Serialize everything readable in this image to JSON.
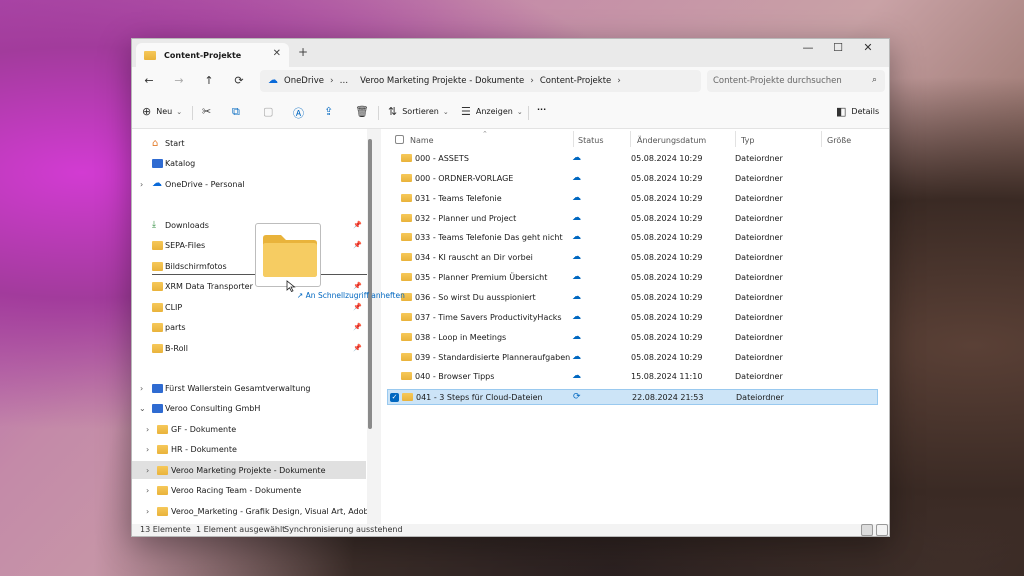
{
  "window": {
    "tab_title": "Content-Projekte",
    "tab_close": "✕",
    "new_tab": "+",
    "controls": {
      "minimize": "—",
      "maximize": "☐",
      "close": "✕"
    }
  },
  "nav": {
    "back": "←",
    "forward": "→",
    "up": "↑",
    "refresh": "⟳",
    "breadcrumb": [
      "OneDrive",
      "…",
      "Veroo Marketing Projekte - Dokumente",
      "Content-Projekte"
    ],
    "search_placeholder": "Content-Projekte durchsuchen"
  },
  "toolbar": {
    "new_label": "Neu",
    "sort_label": "Sortieren",
    "view_label": "Anzeigen",
    "more_label": "···",
    "details_label": "Details"
  },
  "sidebar": {
    "items": [
      {
        "label": "Start",
        "icon": "home-icon"
      },
      {
        "label": "Katalog",
        "icon": "gallery-icon"
      },
      {
        "label": "OneDrive - Personal",
        "icon": "onedrive-icon"
      },
      {
        "label": "Downloads",
        "icon": "download-icon"
      },
      {
        "label": "SEPA-Files",
        "icon": "folder-icon"
      },
      {
        "label": "Bildschirmfotos",
        "icon": "folder-icon"
      },
      {
        "label": "XRM Data Transporter",
        "icon": "folder-icon"
      },
      {
        "label": "CLIP",
        "icon": "folder-icon"
      },
      {
        "label": "parts",
        "icon": "folder-icon"
      },
      {
        "label": "B-Roll",
        "icon": "folder-icon"
      },
      {
        "label": "Fürst Wallerstein Gesamtverwaltung",
        "icon": "sharepoint-icon"
      },
      {
        "label": "Veroo Consulting GmbH",
        "icon": "sharepoint-icon"
      },
      {
        "label": "GF - Dokumente",
        "icon": "folder-icon"
      },
      {
        "label": "HR - Dokumente",
        "icon": "folder-icon"
      },
      {
        "label": "Veroo Marketing Projekte - Dokumente",
        "icon": "folder-icon"
      },
      {
        "label": "Veroo Racing Team - Dokumente",
        "icon": "folder-icon"
      },
      {
        "label": "Veroo_Marketing - Grafik Design, Visual Art, Adobe Creati",
        "icon": "folder-icon"
      }
    ],
    "drag_tooltip": "An Schnellzugriff anheften"
  },
  "columns": {
    "name": "Name",
    "status": "Status",
    "date": "Änderungsdatum",
    "type": "Typ",
    "size": "Größe"
  },
  "files": [
    {
      "name": "000 - ASSETS",
      "date": "05.08.2024 10:29",
      "type": "Dateiordner"
    },
    {
      "name": "000 - ORDNER-VORLAGE",
      "date": "05.08.2024 10:29",
      "type": "Dateiordner"
    },
    {
      "name": "031 - Teams Telefonie",
      "date": "05.08.2024 10:29",
      "type": "Dateiordner"
    },
    {
      "name": "032 - Planner und Project",
      "date": "05.08.2024 10:29",
      "type": "Dateiordner"
    },
    {
      "name": "033 - Teams Telefonie Das geht nicht",
      "date": "05.08.2024 10:29",
      "type": "Dateiordner"
    },
    {
      "name": "034 - KI rauscht an Dir vorbei",
      "date": "05.08.2024 10:29",
      "type": "Dateiordner"
    },
    {
      "name": "035 - Planner Premium Übersicht",
      "date": "05.08.2024 10:29",
      "type": "Dateiordner"
    },
    {
      "name": "036 - So wirst Du ausspioniert",
      "date": "05.08.2024 10:29",
      "type": "Dateiordner"
    },
    {
      "name": "037 - Time Savers ProductivityHacks",
      "date": "05.08.2024 10:29",
      "type": "Dateiordner"
    },
    {
      "name": "038 - Loop in Meetings",
      "date": "05.08.2024 10:29",
      "type": "Dateiordner"
    },
    {
      "name": "039 - Standardisierte Planneraufgaben",
      "date": "05.08.2024 10:29",
      "type": "Dateiordner"
    },
    {
      "name": "040 - Browser Tipps",
      "date": "15.08.2024 11:10",
      "type": "Dateiordner"
    },
    {
      "name": "041 - 3 Steps für Cloud-Dateien",
      "date": "22.08.2024 21:53",
      "type": "Dateiordner",
      "selected": true
    }
  ],
  "status": {
    "count": "13 Elemente",
    "selected": "1 Element ausgewählt",
    "sync": "Synchronisierung ausstehend"
  },
  "colors": {
    "accent": "#0067c0",
    "folder": "#f2c04d",
    "selection": "#cce4f7"
  }
}
